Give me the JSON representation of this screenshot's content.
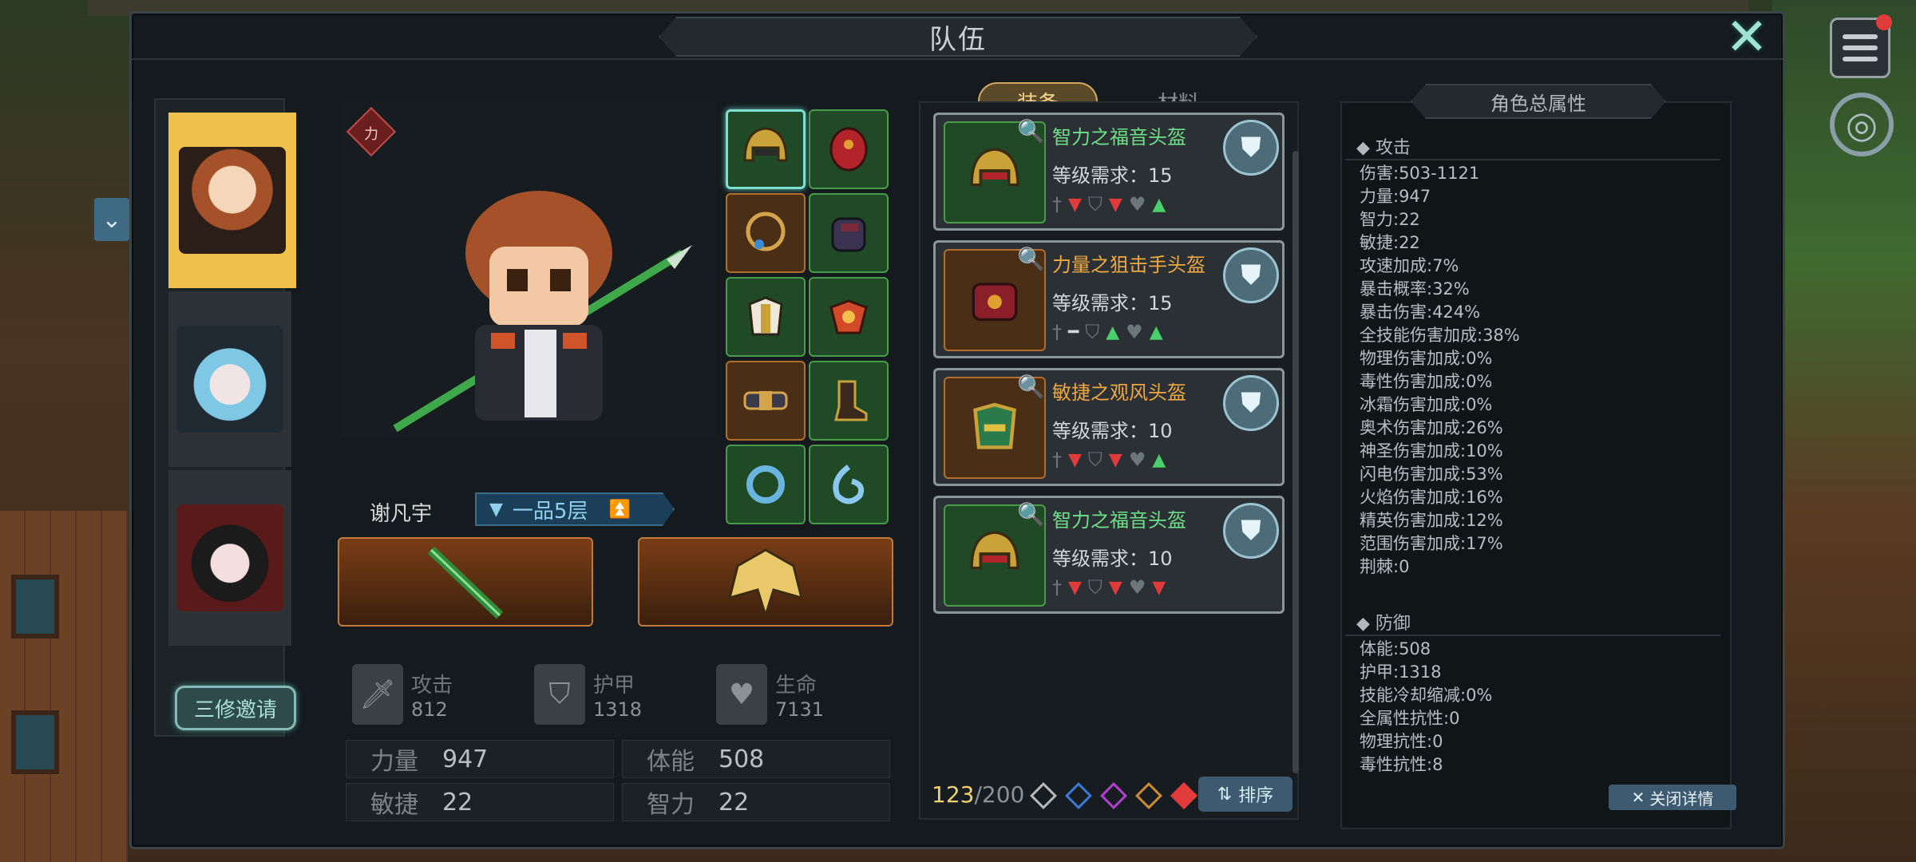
{
  "window": {
    "title": "队伍",
    "close_icon": "close-icon"
  },
  "party": {
    "members": [
      {
        "name": "brown-hair-hero",
        "active": true
      },
      {
        "name": "white-hat-blue-hair",
        "active": false
      },
      {
        "name": "black-hair-red-eyes",
        "active": false
      }
    ],
    "invite_label": "三修邀请"
  },
  "hero": {
    "force_badge": "力",
    "name": "谢凡宇",
    "rank": "一品5层"
  },
  "stats_summary": {
    "attack_label": "攻击",
    "attack_value": "812",
    "armor_label": "护甲",
    "armor_value": "1318",
    "life_label": "生命",
    "life_value": "7131"
  },
  "core_stats": {
    "str_label": "力量",
    "str_value": "947",
    "vit_label": "体能",
    "vit_value": "508",
    "agi_label": "敏捷",
    "agi_value": "22",
    "int_label": "智力",
    "int_value": "22"
  },
  "tabs": {
    "equip": "装备",
    "material": "材料"
  },
  "equip_list": [
    {
      "name": "智力之福音头盔",
      "req": "等级需求：15",
      "rarity": "green",
      "cmp": [
        "down",
        "down",
        "up"
      ]
    },
    {
      "name": "力量之狙击手头盔",
      "req": "等级需求：15",
      "rarity": "orange",
      "cmp": [
        "flat",
        "up",
        "up"
      ]
    },
    {
      "name": "敏捷之观风头盔",
      "req": "等级需求：10",
      "rarity": "orange",
      "cmp": [
        "down",
        "down",
        "up"
      ]
    },
    {
      "name": "智力之福音头盔",
      "req": "等级需求：10",
      "rarity": "green",
      "cmp": [
        "down",
        "down",
        "down"
      ]
    }
  ],
  "bag": {
    "current": "123",
    "max": "/200",
    "sort_label": "排序"
  },
  "attributes": {
    "header": "角色总属性",
    "attack_title": "攻击",
    "attack": [
      "伤害:503-1121",
      "力量:947",
      "智力:22",
      "敏捷:22",
      "攻速加成:7%",
      "暴击概率:32%",
      "暴击伤害:424%",
      "全技能伤害加成:38%",
      "物理伤害加成:0%",
      "毒性伤害加成:0%",
      "冰霜伤害加成:0%",
      "奥术伤害加成:26%",
      "神圣伤害加成:10%",
      "闪电伤害加成:53%",
      "火焰伤害加成:16%",
      "精英伤害加成:12%",
      "范围伤害加成:17%",
      "荆棘:0"
    ],
    "defense_title": "防御",
    "defense": [
      "体能:508",
      "护甲:1318",
      "技能冷却缩减:0%",
      "全属性抗性:0",
      "物理抗性:0",
      "毒性抗性:8"
    ],
    "close_detail": "关闭详情"
  },
  "colors": {
    "accent_gold": "#f0c04a",
    "green_rarity": "#4a9a4c",
    "orange_rarity": "#b0702c",
    "stat_down": "#e03a3a",
    "stat_up": "#4ad06a"
  }
}
